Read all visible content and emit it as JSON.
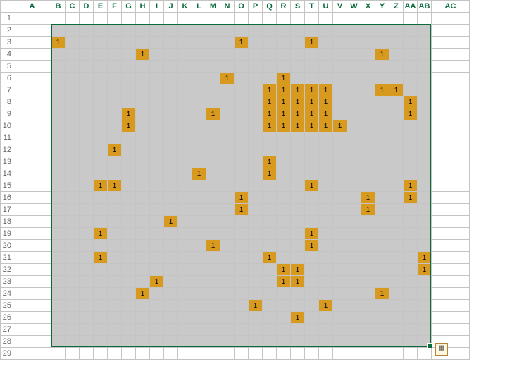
{
  "grid": {
    "rowHeaderWidth": 18,
    "colA_width": 54,
    "narrowColWidth": 20,
    "colAC_width": 54,
    "rows": 29,
    "dataRowStart": 2,
    "dataRowEnd": 28,
    "columns": [
      "A",
      "B",
      "C",
      "D",
      "E",
      "F",
      "G",
      "H",
      "I",
      "J",
      "K",
      "L",
      "M",
      "N",
      "O",
      "P",
      "Q",
      "R",
      "S",
      "T",
      "U",
      "V",
      "W",
      "X",
      "Y",
      "Z",
      "AA",
      "AB",
      "AC"
    ],
    "dataColStart": 1,
    "dataColEnd": 27,
    "cellValue": "1",
    "filled": [
      {
        "r": 3,
        "c": 1
      },
      {
        "r": 3,
        "c": 14
      },
      {
        "r": 3,
        "c": 19
      },
      {
        "r": 4,
        "c": 7
      },
      {
        "r": 4,
        "c": 24
      },
      {
        "r": 6,
        "c": 13
      },
      {
        "r": 6,
        "c": 17
      },
      {
        "r": 7,
        "c": 16
      },
      {
        "r": 7,
        "c": 17
      },
      {
        "r": 7,
        "c": 18
      },
      {
        "r": 7,
        "c": 19
      },
      {
        "r": 7,
        "c": 20
      },
      {
        "r": 7,
        "c": 24
      },
      {
        "r": 7,
        "c": 25
      },
      {
        "r": 8,
        "c": 16
      },
      {
        "r": 8,
        "c": 17
      },
      {
        "r": 8,
        "c": 18
      },
      {
        "r": 8,
        "c": 19
      },
      {
        "r": 8,
        "c": 20
      },
      {
        "r": 8,
        "c": 26
      },
      {
        "r": 9,
        "c": 6
      },
      {
        "r": 9,
        "c": 12
      },
      {
        "r": 9,
        "c": 16
      },
      {
        "r": 9,
        "c": 17
      },
      {
        "r": 9,
        "c": 18
      },
      {
        "r": 9,
        "c": 19
      },
      {
        "r": 9,
        "c": 20
      },
      {
        "r": 9,
        "c": 26
      },
      {
        "r": 10,
        "c": 6
      },
      {
        "r": 10,
        "c": 16
      },
      {
        "r": 10,
        "c": 17
      },
      {
        "r": 10,
        "c": 18
      },
      {
        "r": 10,
        "c": 19
      },
      {
        "r": 10,
        "c": 20
      },
      {
        "r": 10,
        "c": 21
      },
      {
        "r": 12,
        "c": 5
      },
      {
        "r": 13,
        "c": 16
      },
      {
        "r": 14,
        "c": 11
      },
      {
        "r": 14,
        "c": 16
      },
      {
        "r": 15,
        "c": 4
      },
      {
        "r": 15,
        "c": 5
      },
      {
        "r": 15,
        "c": 19
      },
      {
        "r": 15,
        "c": 26
      },
      {
        "r": 16,
        "c": 14
      },
      {
        "r": 16,
        "c": 23
      },
      {
        "r": 16,
        "c": 26
      },
      {
        "r": 17,
        "c": 14
      },
      {
        "r": 17,
        "c": 23
      },
      {
        "r": 18,
        "c": 9
      },
      {
        "r": 19,
        "c": 4
      },
      {
        "r": 19,
        "c": 19
      },
      {
        "r": 20,
        "c": 12
      },
      {
        "r": 20,
        "c": 19
      },
      {
        "r": 21,
        "c": 4
      },
      {
        "r": 21,
        "c": 16
      },
      {
        "r": 21,
        "c": 27
      },
      {
        "r": 22,
        "c": 17
      },
      {
        "r": 22,
        "c": 18
      },
      {
        "r": 22,
        "c": 27
      },
      {
        "r": 23,
        "c": 8
      },
      {
        "r": 23,
        "c": 17
      },
      {
        "r": 23,
        "c": 18
      },
      {
        "r": 24,
        "c": 7
      },
      {
        "r": 24,
        "c": 24
      },
      {
        "r": 25,
        "c": 15
      },
      {
        "r": 25,
        "c": 20
      },
      {
        "r": 26,
        "c": 18
      }
    ]
  },
  "colors": {
    "headerText": "#0a6b3b",
    "gridLine": "#c4c4c4",
    "dataBg": "#c9c9c9",
    "filledBg": "#d89a1e",
    "selection": "#0a6b3b"
  }
}
